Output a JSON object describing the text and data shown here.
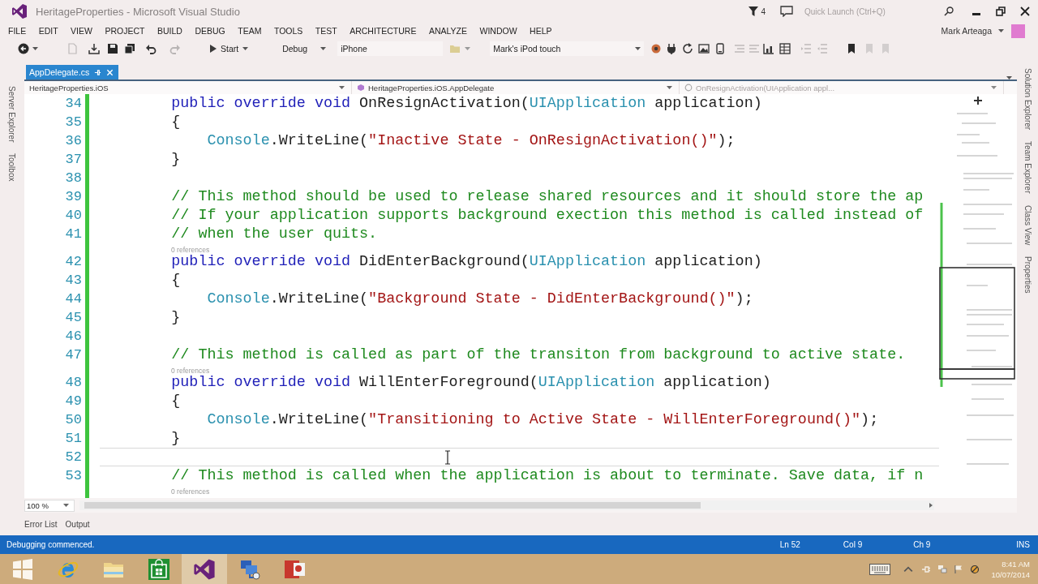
{
  "window": {
    "title": "HeritageProperties - Microsoft Visual Studio",
    "notification_count": "4",
    "quick_launch": {
      "placeholder": "Quick Launch (Ctrl+Q)"
    }
  },
  "menu": [
    "FILE",
    "EDIT",
    "VIEW",
    "PROJECT",
    "BUILD",
    "DEBUG",
    "TEAM",
    "TOOLS",
    "TEST",
    "ARCHITECTURE",
    "ANALYZE",
    "WINDOW",
    "HELP"
  ],
  "account": {
    "name": "Mark Arteaga"
  },
  "toolbar": {
    "start": "Start",
    "configuration": "Debug",
    "platform": "iPhone",
    "device": "Mark's iPod touch"
  },
  "left_tool_tabs": [
    "Server Explorer",
    "Toolbox"
  ],
  "document_tabs": [
    {
      "label": "AppDelegate.cs",
      "selected": true
    }
  ],
  "navigation_bar": {
    "project": "HeritageProperties.iOS",
    "type": "HeritageProperties.iOS.AppDelegate",
    "member": "OnResignActivation(UIApplication appl..."
  },
  "editor": {
    "lines": [
      {
        "kind": "code",
        "number": "34",
        "tokens": [
          {
            "kind": "keyword",
            "text": "        public override void"
          },
          {
            "kind": "plain",
            "text": " OnResignActivation("
          },
          {
            "kind": "type",
            "text": "UIApplication"
          },
          {
            "kind": "plain",
            "text": " application)"
          }
        ],
        "current": false
      },
      {
        "kind": "code",
        "number": "35",
        "tokens": [
          {
            "kind": "plain",
            "text": "        {"
          }
        ],
        "current": false
      },
      {
        "kind": "code",
        "number": "36",
        "tokens": [
          {
            "kind": "type",
            "text": "            Console"
          },
          {
            "kind": "plain",
            "text": ".WriteLine("
          },
          {
            "kind": "string",
            "text": "\"Inactive State - OnResignActivation()\""
          },
          {
            "kind": "plain",
            "text": ");"
          }
        ],
        "current": false
      },
      {
        "kind": "code",
        "number": "37",
        "tokens": [
          {
            "kind": "plain",
            "text": "        }"
          }
        ],
        "current": false
      },
      {
        "kind": "code",
        "number": "38",
        "current": false
      },
      {
        "kind": "code",
        "number": "39",
        "tokens": [
          {
            "kind": "comment",
            "text": "        // This method should be used to release shared resources and it should store the ap"
          }
        ],
        "current": false
      },
      {
        "kind": "code",
        "number": "40",
        "tokens": [
          {
            "kind": "comment",
            "text": "        // If your application supports background exection this method is called instead of"
          }
        ],
        "current": false
      },
      {
        "kind": "code",
        "number": "41",
        "tokens": [
          {
            "kind": "comment",
            "text": "        // when the user quits."
          }
        ],
        "current": false
      },
      {
        "kind": "codelens",
        "text": "0 references"
      },
      {
        "kind": "code",
        "number": "42",
        "tokens": [
          {
            "kind": "keyword",
            "text": "        public override void"
          },
          {
            "kind": "plain",
            "text": " DidEnterBackground("
          },
          {
            "kind": "type",
            "text": "UIApplication"
          },
          {
            "kind": "plain",
            "text": " application)"
          }
        ],
        "current": false
      },
      {
        "kind": "code",
        "number": "43",
        "tokens": [
          {
            "kind": "plain",
            "text": "        {"
          }
        ],
        "current": false
      },
      {
        "kind": "code",
        "number": "44",
        "tokens": [
          {
            "kind": "type",
            "text": "            Console"
          },
          {
            "kind": "plain",
            "text": ".WriteLine("
          },
          {
            "kind": "string",
            "text": "\"Background State - DidEnterBackground()\""
          },
          {
            "kind": "plain",
            "text": ");"
          }
        ],
        "current": false
      },
      {
        "kind": "code",
        "number": "45",
        "tokens": [
          {
            "kind": "plain",
            "text": "        }"
          }
        ],
        "current": false
      },
      {
        "kind": "code",
        "number": "46",
        "current": false
      },
      {
        "kind": "code",
        "number": "47",
        "tokens": [
          {
            "kind": "comment",
            "text": "        // This method is called as part of the transiton from background to active state."
          }
        ],
        "current": false
      },
      {
        "kind": "codelens",
        "text": "0 references"
      },
      {
        "kind": "code",
        "number": "48",
        "tokens": [
          {
            "kind": "keyword",
            "text": "        public override void"
          },
          {
            "kind": "plain",
            "text": " WillEnterForeground("
          },
          {
            "kind": "type",
            "text": "UIApplication"
          },
          {
            "kind": "plain",
            "text": " application)"
          }
        ],
        "current": false
      },
      {
        "kind": "code",
        "number": "49",
        "tokens": [
          {
            "kind": "plain",
            "text": "        {"
          }
        ],
        "current": false
      },
      {
        "kind": "code",
        "number": "50",
        "tokens": [
          {
            "kind": "type",
            "text": "            Console"
          },
          {
            "kind": "plain",
            "text": ".WriteLine("
          },
          {
            "kind": "string",
            "text": "\"Transitioning to Active State - WillEnterForeground()\""
          },
          {
            "kind": "plain",
            "text": ");"
          }
        ],
        "current": false
      },
      {
        "kind": "code",
        "number": "51",
        "tokens": [
          {
            "kind": "plain",
            "text": "        }"
          }
        ],
        "current": false
      },
      {
        "kind": "code",
        "number": "52",
        "current": true
      },
      {
        "kind": "code",
        "number": "53",
        "tokens": [
          {
            "kind": "comment",
            "text": "        // This method is called when the application is about to terminate. Save data, if n"
          }
        ],
        "current": false
      },
      {
        "kind": "codelens",
        "text": "0 references"
      }
    ],
    "zoom": "100 %"
  },
  "right_tool_tabs": [
    "Solution Explorer",
    "Team Explorer",
    "Class View",
    "Properties"
  ],
  "bottom_tabs": [
    "Error List",
    "Output"
  ],
  "status_bar": {
    "message": "Debugging commenced.",
    "line": "Ln 52",
    "column": "Col 9",
    "character": "Ch 9",
    "mode": "INS"
  },
  "taskbar": {
    "items": [
      {
        "kind": "start",
        "active": false
      },
      {
        "kind": "browser",
        "active": false
      },
      {
        "kind": "files",
        "active": false
      },
      {
        "kind": "store",
        "active": false
      },
      {
        "kind": "visual_studio",
        "active": true
      },
      {
        "kind": "remote",
        "active": false
      },
      {
        "kind": "presentation",
        "active": false
      }
    ],
    "clock": {
      "time": "8:41 AM",
      "date": "10/07/2014"
    }
  }
}
